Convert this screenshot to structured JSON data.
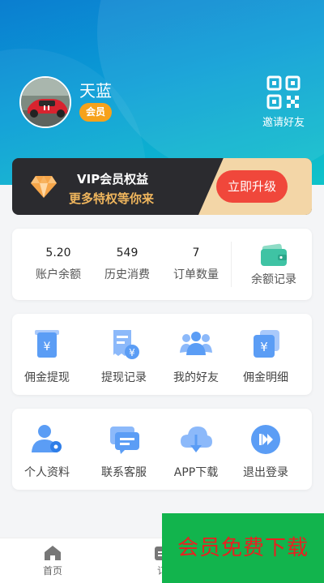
{
  "colors": {
    "header_gradient_start": "#0b7ed0",
    "header_gradient_end": "#0fc3c9",
    "member_badge": "#f6a21b",
    "vip_dark": "#2b2b2f",
    "vip_gold_text": "#f0b65d",
    "upgrade_button": "#f0473b",
    "icon_blue": "#5b9df5",
    "wallet_teal": "#3fc3a4",
    "promo_bg": "#12b44d",
    "promo_text": "#e82020"
  },
  "profile": {
    "name": "天蓝",
    "badge": "会员",
    "invite_label": "邀请好友",
    "invite_icon": "qr-code-icon"
  },
  "vip": {
    "title": "VIP会员权益",
    "subtitle": "更多特权等你来",
    "button": "立即升级",
    "icon": "diamond-icon"
  },
  "stats": {
    "items": [
      {
        "value": "5.20",
        "label": "账户余额"
      },
      {
        "value": "549",
        "label": "历史消费"
      },
      {
        "value": "7",
        "label": "订单数量"
      }
    ],
    "wallet": {
      "label": "余额记录",
      "icon": "wallet-icon"
    }
  },
  "grid1": [
    {
      "label": "佣金提现",
      "icon": "withdraw-icon"
    },
    {
      "label": "提现记录",
      "icon": "receipt-icon"
    },
    {
      "label": "我的好友",
      "icon": "friends-icon"
    },
    {
      "label": "佣金明细",
      "icon": "commission-icon"
    }
  ],
  "grid2": [
    {
      "label": "个人资料",
      "icon": "user-profile-icon"
    },
    {
      "label": "联系客服",
      "icon": "chat-icon"
    },
    {
      "label": "APP下载",
      "icon": "cloud-download-icon"
    },
    {
      "label": "退出登录",
      "icon": "logout-icon"
    }
  ],
  "tabbar": {
    "home": "首页",
    "orders_partial": "订"
  },
  "promo": {
    "text": "会员免费下载"
  }
}
